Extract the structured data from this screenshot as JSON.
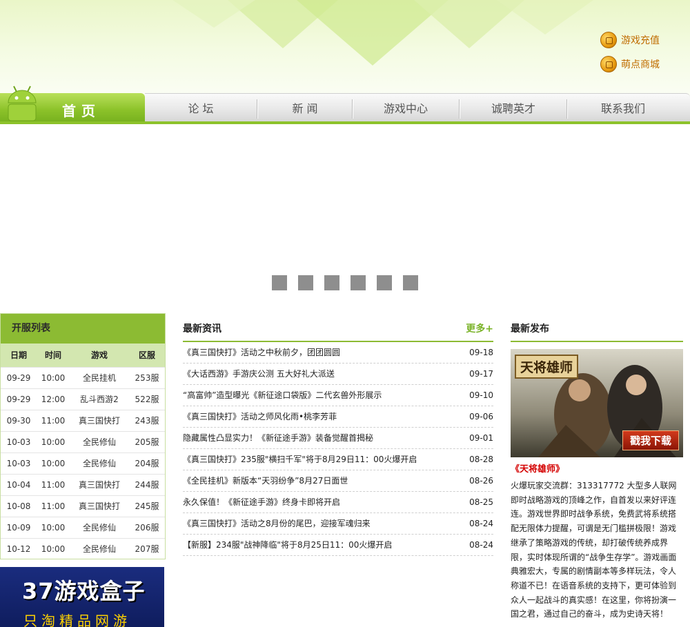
{
  "header": {
    "links": [
      {
        "label": "游戏充值",
        "icon": "coin-recharge-icon"
      },
      {
        "label": "萌点商城",
        "icon": "coin-shop-icon"
      }
    ]
  },
  "nav": {
    "home": "首页",
    "items": [
      "论 坛",
      "新 闻",
      "游戏中心",
      "诚聘英才",
      "联系我们"
    ]
  },
  "banner": {
    "slide_count": 6
  },
  "servers": {
    "title": "开服列表",
    "columns": [
      "日期",
      "时间",
      "游戏",
      "区服"
    ],
    "rows": [
      [
        "09-29",
        "10:00",
        "全民挂机",
        "253服"
      ],
      [
        "09-29",
        "12:00",
        "乱斗西游2",
        "522服"
      ],
      [
        "09-30",
        "11:00",
        "真三国快打",
        "243服"
      ],
      [
        "10-03",
        "10:00",
        "全民修仙",
        "205服"
      ],
      [
        "10-03",
        "10:00",
        "全民修仙",
        "204服"
      ],
      [
        "10-04",
        "11:00",
        "真三国快打",
        "244服"
      ],
      [
        "10-08",
        "11:00",
        "真三国快打",
        "245服"
      ],
      [
        "10-09",
        "10:00",
        "全民修仙",
        "206服"
      ],
      [
        "10-12",
        "10:00",
        "全民修仙",
        "207服"
      ]
    ]
  },
  "ad": {
    "title": "37游戏盒子",
    "subtitle": "只淘精品网游"
  },
  "news": {
    "title": "最新资讯",
    "more": "更多+",
    "items": [
      {
        "title": "《真三国快打》活动之中秋前夕，团团圆圆",
        "date": "09-18"
      },
      {
        "title": "《大话西游》手游庆公测 五大好礼大派送",
        "date": "09-17"
      },
      {
        "title": "“高富帅”造型曝光《新征途口袋版》二代玄兽外形展示",
        "date": "09-10"
      },
      {
        "title": "《真三国快打》活动之师风化雨•桃李芳菲",
        "date": "09-06"
      },
      {
        "title": "隐藏属性凸显实力！《新征途手游》装备觉醒首揭秘",
        "date": "09-01"
      },
      {
        "title": "《真三国快打》235服\"横扫千军\"将于8月29日11：00火爆开启",
        "date": "08-28"
      },
      {
        "title": "《全民挂机》新版本“天羽纷争”8月27日面世",
        "date": "08-26"
      },
      {
        "title": "永久保值！《新征途手游》终身卡即将开启",
        "date": "08-25"
      },
      {
        "title": "《真三国快打》活动之8月份的尾巴，迎接军魂归来",
        "date": "08-24"
      },
      {
        "title": "【新服】234服\"战神降临\"将于8月25日11：00火爆开启",
        "date": "08-24"
      }
    ]
  },
  "release": {
    "title": "最新发布",
    "game_logo": "天将雄师",
    "download": "戳我下载",
    "name": "《天将雄师》",
    "description": "火爆玩家交流群：313317772 大型多人联网即时战略游戏的顶峰之作，自首发以来好评连连。游戏世界即时战争系统，免费武将系统搭配无限体力提醒，可谓是无门槛拼极限！游戏继承了策略游戏的传统，却打破传统养成界限，实时体现所谓的“战争生存学”。游戏画面典雅宏大，专属的剧情副本等多样玩法，令人称道不已！在语音系统的支持下，更可体验到众人一起战斗的真实感！在这里，你将扮演一国之君，通过自己的奋斗，成为史诗天将！"
  }
}
